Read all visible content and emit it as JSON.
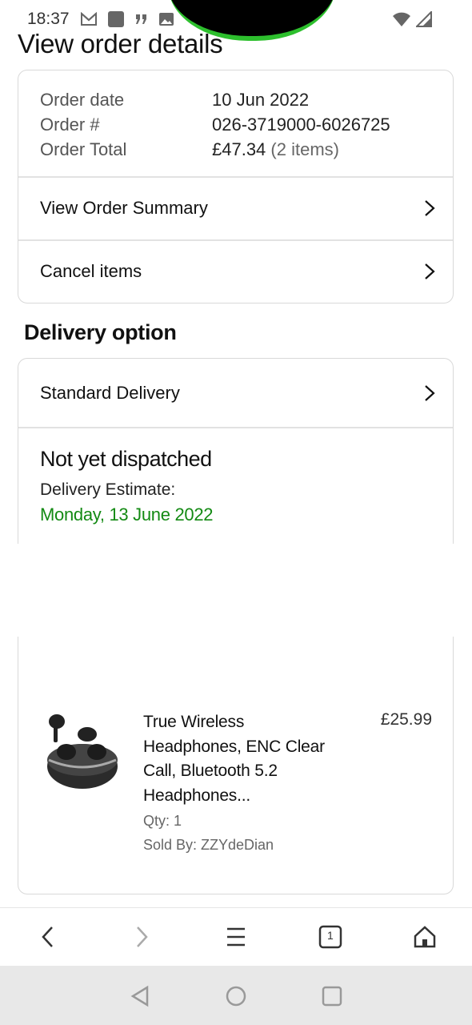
{
  "status": {
    "time": "18:37"
  },
  "page": {
    "title": "View order details"
  },
  "order": {
    "date_label": "Order date",
    "date_value": "10 Jun 2022",
    "number_label": "Order #",
    "number_value": "026-3719000-6026725",
    "total_label": "Order Total",
    "total_value": "£47.34",
    "total_items": "(2 items)",
    "summary_link": "View Order Summary",
    "cancel_link": "Cancel items"
  },
  "delivery": {
    "section_title": "Delivery option",
    "option_label": "Standard Delivery",
    "status": "Not yet dispatched",
    "estimate_label": "Delivery Estimate:",
    "estimate_date": "Monday, 13 June 2022"
  },
  "item": {
    "name": "True Wireless Headphones, ENC Clear Call, Bluetooth 5.2 Headphones...",
    "price": "£25.99",
    "qty": "Qty: 1",
    "seller": "Sold By: ZZYdeDian"
  },
  "icons": {
    "status_left": [
      "gmail-icon",
      "app-icon",
      "quote-icon",
      "image-icon"
    ],
    "status_right": [
      "wifi-icon",
      "signal-icon"
    ],
    "browser": [
      "back-icon",
      "forward-icon",
      "menu-icon",
      "tabs-icon",
      "home-icon"
    ],
    "system": [
      "nav-back-icon",
      "nav-home-icon",
      "nav-recents-icon"
    ]
  },
  "browser": {
    "tab_count": "1"
  },
  "colors": {
    "accent_green": "#138a13",
    "border": "#d9d9d9"
  }
}
